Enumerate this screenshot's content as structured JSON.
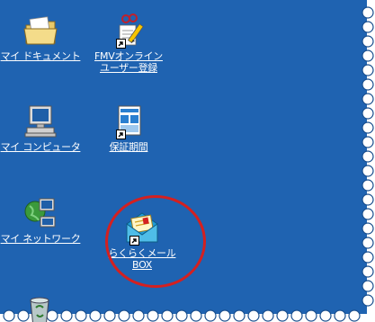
{
  "desktop": {
    "background_color": "#1f63b1",
    "torn_edge_color": "#ffffff",
    "icons": [
      {
        "id": "my-documents",
        "label_lines": [
          "マイ ドキュメント"
        ],
        "icon": "folder-icon",
        "shortcut": false
      },
      {
        "id": "fmv-online",
        "label_lines": [
          "FMVオンライン",
          "ユーザー登録"
        ],
        "icon": "fmv-pencil-icon",
        "shortcut": true
      },
      {
        "id": "my-computer",
        "label_lines": [
          "マイ コンピュータ"
        ],
        "icon": "computer-icon",
        "shortcut": false
      },
      {
        "id": "warranty",
        "label_lines": [
          "保証期間"
        ],
        "icon": "warranty-document-icon",
        "shortcut": true
      },
      {
        "id": "my-network",
        "label_lines": [
          "マイ ネットワーク"
        ],
        "icon": "network-icon",
        "shortcut": false
      },
      {
        "id": "rakuraku-mail",
        "label_lines": [
          "らくらくメール",
          "BOX"
        ],
        "icon": "mail-envelope-icon",
        "shortcut": true
      },
      {
        "id": "recycle-bin",
        "label_lines": [],
        "icon": "recycle-bin-icon",
        "shortcut": false
      }
    ]
  },
  "annotation": {
    "circled_item": "rakuraku-mail",
    "color": "#d42020"
  }
}
